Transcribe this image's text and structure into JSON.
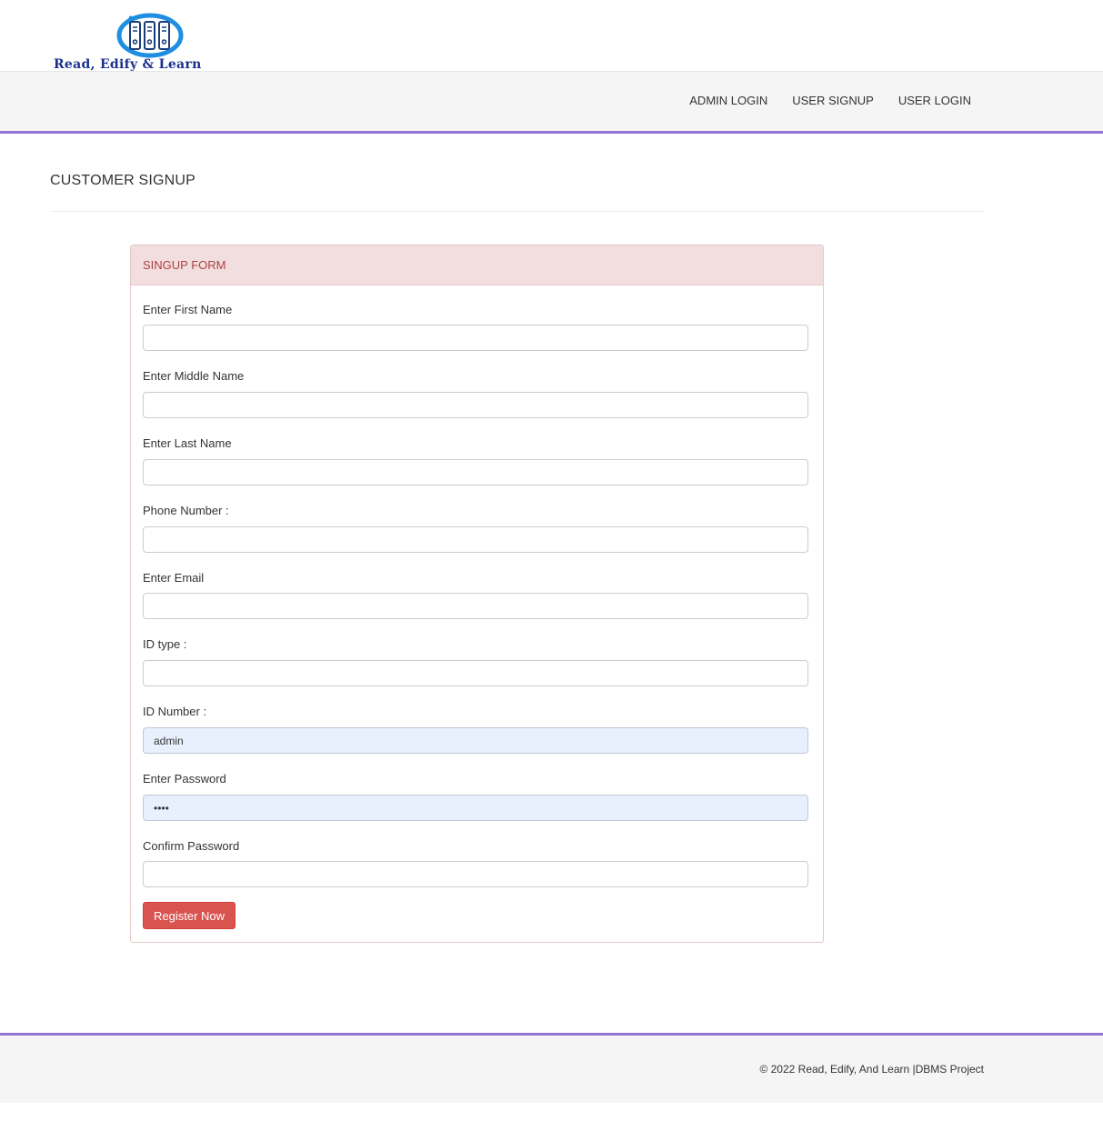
{
  "brand": {
    "name": "Read, Edify & Learn"
  },
  "nav": {
    "items": [
      {
        "label": "ADMIN LOGIN"
      },
      {
        "label": "USER SIGNUP"
      },
      {
        "label": "USER LOGIN"
      }
    ]
  },
  "page": {
    "title": "CUSTOMER SIGNUP"
  },
  "form": {
    "heading": "SINGUP FORM",
    "fields": [
      {
        "label": "Enter First Name",
        "value": ""
      },
      {
        "label": "Enter Middle Name",
        "value": ""
      },
      {
        "label": "Enter Last Name",
        "value": ""
      },
      {
        "label": "Phone Number :",
        "value": ""
      },
      {
        "label": "Enter Email",
        "value": ""
      },
      {
        "label": "ID type :",
        "value": ""
      },
      {
        "label": "ID Number :",
        "value": "admin"
      },
      {
        "label": "Enter Password",
        "value": "••••"
      },
      {
        "label": "Confirm Password",
        "value": ""
      }
    ],
    "submit_label": "Register Now"
  },
  "footer": {
    "text": "© 2022 Read, Edify, And Learn |DBMS Project"
  },
  "colors": {
    "accent": "#9373d6",
    "panel_heading_bg": "#f2dede",
    "panel_heading_text": "#a94442",
    "button": "#d9534f",
    "autofill_bg": "#e8f0fe"
  }
}
